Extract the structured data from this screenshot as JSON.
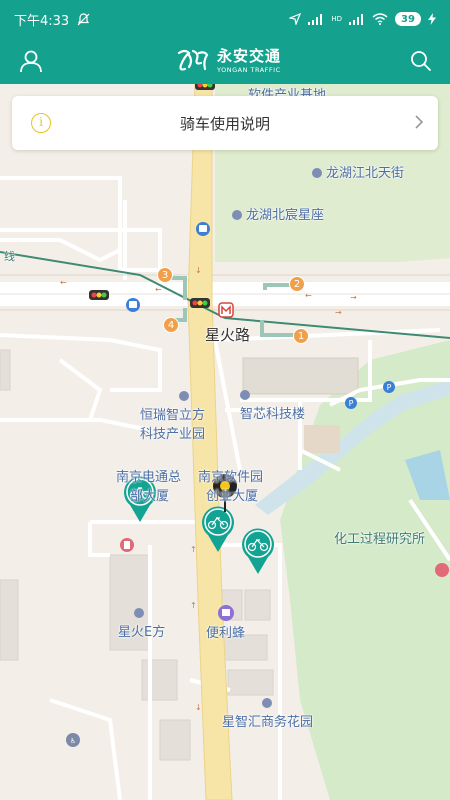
{
  "status_bar": {
    "time": "下午4:33",
    "network": "4G",
    "hd": "HD",
    "battery": "39"
  },
  "header": {
    "logo_cn": "永安交通",
    "logo_en": "YONGAN TRAFFIC"
  },
  "guide_card": {
    "title": "骑车使用说明"
  },
  "map": {
    "labels": {
      "software_top": "软件产业基地",
      "longhu_street": "龙湖江北天街",
      "longhu_plaza": "龙湖北宸星座",
      "metro_line": "线",
      "xinghuo_road": "星火路",
      "zhixin": "智芯科技楼",
      "hengrui_1": "恒瑞智立方",
      "hengrui_2": "科技产业园",
      "nanjing_a1": "南京电通总",
      "nanjing_a2": "部大厦",
      "nanjing_b1": "南京软件园",
      "nanjing_b2": "创业大厦",
      "chemical": "化工过程研究所",
      "xinghuo_e": "星火E方",
      "convenience": "便利蜂",
      "xingzhi": "星智汇商务花园"
    },
    "badges": [
      "1",
      "2",
      "3",
      "4"
    ]
  }
}
